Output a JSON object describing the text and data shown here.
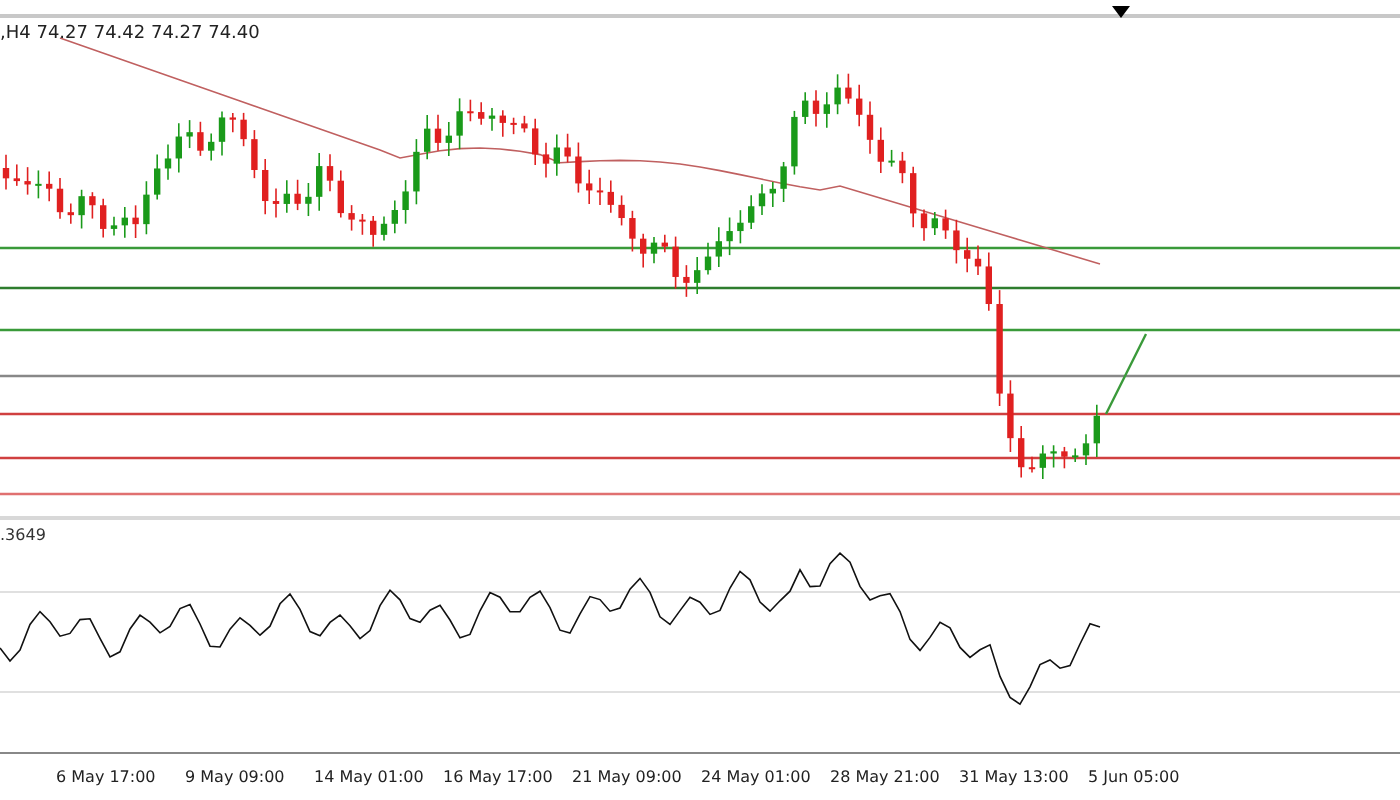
{
  "price_pane": {
    "legend": ",H4  74.27 74.42 74.27 74.40"
  },
  "indicator_pane": {
    "label": ".3649"
  },
  "time_axis": {
    "labels": [
      "6 May 17:00",
      "9 May 09:00",
      "14 May 01:00",
      "16 May 17:00",
      "21 May 09:00",
      "24 May 01:00",
      "28 May 21:00",
      "31 May 13:00",
      "5 Jun 05:00"
    ]
  }
}
